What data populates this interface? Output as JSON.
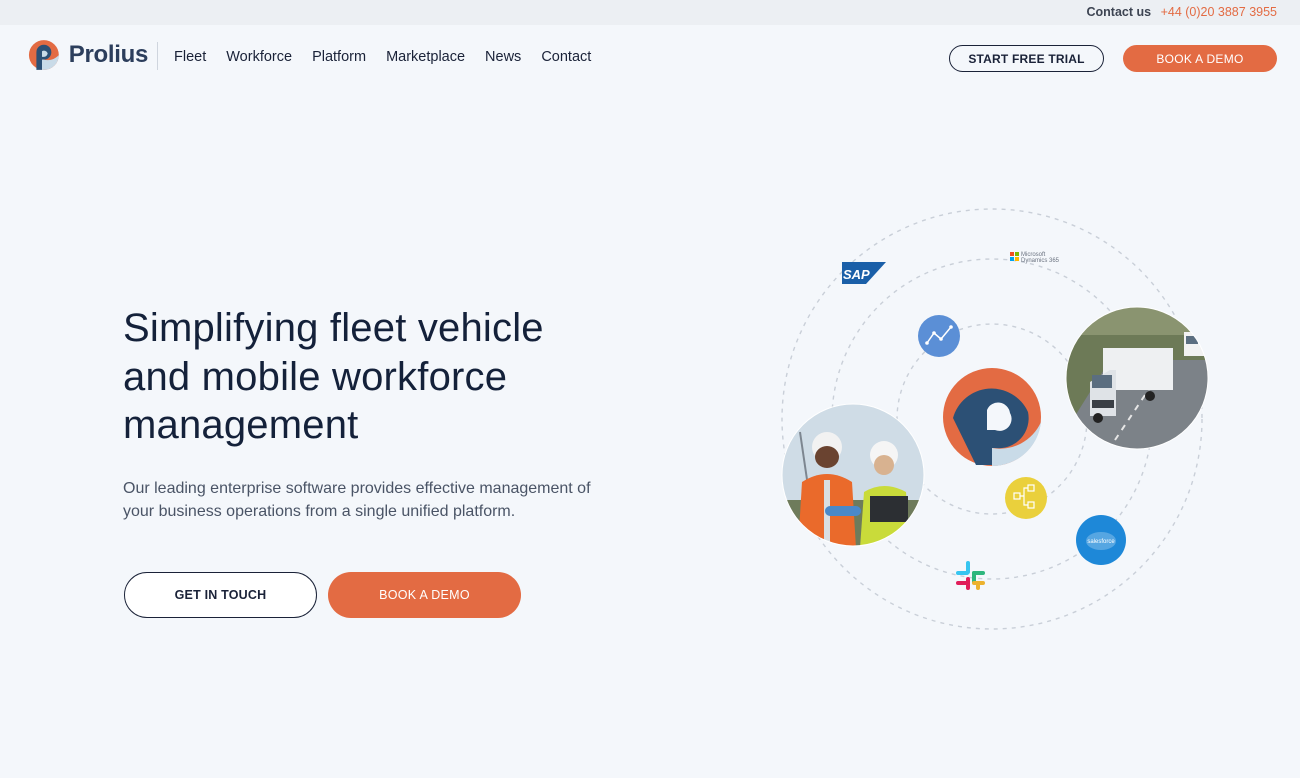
{
  "topbar": {
    "contact_label": "Contact us",
    "phone": "+44 (0)20 3887 3955"
  },
  "brand": {
    "name": "Prolius",
    "accent": "#e36b43",
    "navy": "#2c5075"
  },
  "nav": {
    "items": [
      "Fleet",
      "Workforce",
      "Platform",
      "Marketplace",
      "News",
      "Contact"
    ]
  },
  "header_actions": {
    "trial_label": "START FREE TRIAL",
    "demo_label": "BOOK A DEMO"
  },
  "hero": {
    "title_line1": "Simplifying fleet vehicle",
    "title_line2": "and mobile workforce",
    "title_line3": "management",
    "subtitle_line1": "Our leading enterprise software provides effective management of",
    "subtitle_line2": "your business operations from a single unified platform.",
    "cta_touch": "GET IN TOUCH",
    "cta_demo": "BOOK A DEMO"
  },
  "integrations": {
    "sap": "SAP",
    "ms_line1": "Microsoft",
    "ms_line2": "Dynamics 365",
    "salesforce": "salesforce",
    "icons": [
      "sap-logo",
      "microsoft-dynamics-logo",
      "analytics-icon",
      "workflow-icon",
      "salesforce-logo",
      "slack-logo",
      "prolius-logo",
      "truck-photo",
      "workers-photo"
    ]
  }
}
